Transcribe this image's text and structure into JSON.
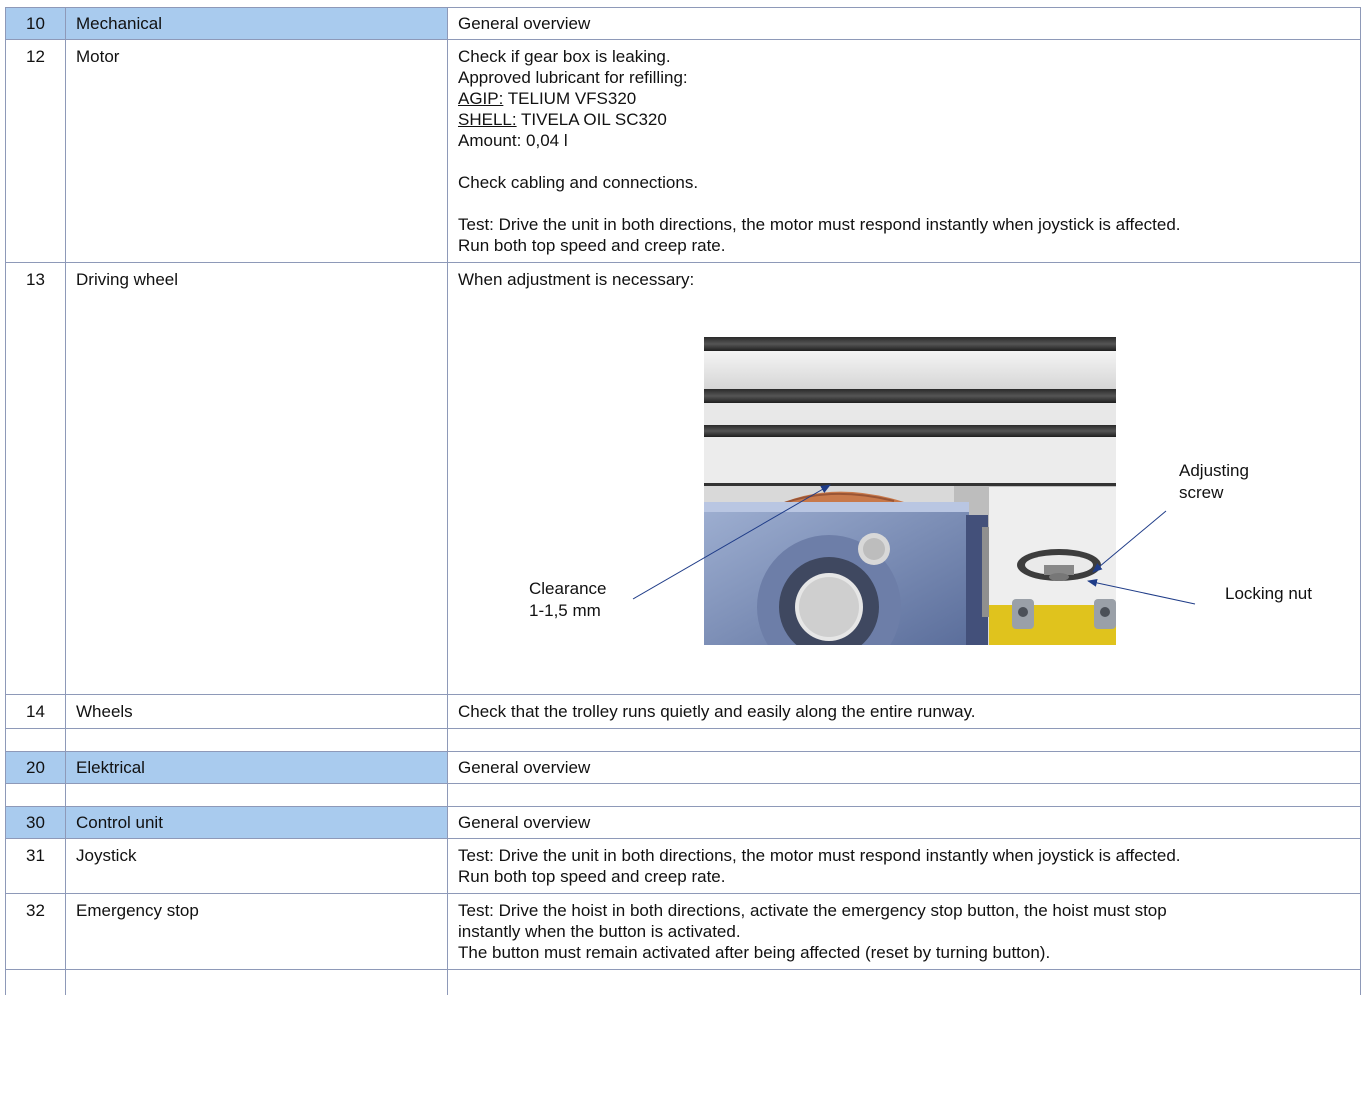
{
  "rows": [
    {
      "num": "10",
      "name": "Mechanical",
      "desc": "General overview"
    },
    {
      "num": "12",
      "name": "Motor",
      "desc": {
        "l1": "Check if gear box is leaking.",
        "l2": "Approved lubricant for refilling:",
        "l3_label": "AGIP:",
        "l3_value": " TELIUM VFS320",
        "l4_label": "SHELL:",
        "l4_value": " TIVELA OIL SC320",
        "l5": "Amount: 0,04 l",
        "l6": "Check cabling and connections.",
        "l7": "Test: Drive the unit in both directions, the motor must respond instantly when joystick is affected.",
        "l8": "Run both top speed and creep rate."
      }
    },
    {
      "num": "13",
      "name": "Driving wheel",
      "desc": "When adjustment is necessary:"
    },
    {
      "num": "14",
      "name": "Wheels",
      "desc": "Check that the trolley runs quietly and easily along the entire runway."
    },
    {
      "num": "20",
      "name": "Elektrical",
      "desc": "General overview"
    },
    {
      "num": "30",
      "name": "Control unit",
      "desc": "General overview"
    },
    {
      "num": "31",
      "name": "Joystick",
      "desc": {
        "l1": "Test: Drive the unit in both directions, the motor must respond instantly when joystick is affected.",
        "l2": "Run both top speed and creep rate."
      }
    },
    {
      "num": "32",
      "name": "Emergency stop",
      "desc": {
        "l1": "Test: Drive the hoist in both directions, activate the emergency stop button, the hoist must stop",
        "l2": "instantly when the button is activated.",
        "l3": "The button must remain activated after being affected (reset by turning button)."
      }
    }
  ],
  "figure": {
    "callouts": {
      "adjusting_1": "Adjusting",
      "adjusting_2": "screw",
      "clearance_1": "Clearance",
      "clearance_2": "1-1,5 mm",
      "locking": "Locking nut"
    }
  },
  "colors": {
    "section_fill": "#a9cbee",
    "grid_line": "#8e99b8",
    "arrow": "#1f3c88"
  }
}
